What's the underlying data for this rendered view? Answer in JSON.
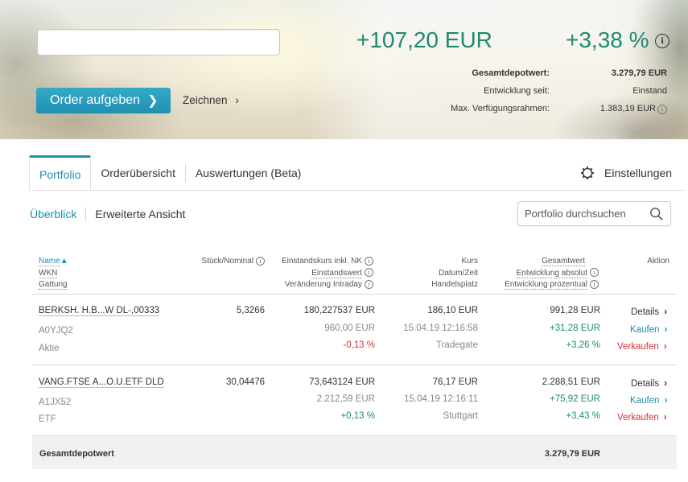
{
  "hero": {
    "search_value": "",
    "order_button": "Order aufgeben",
    "sign_link": "Zeichnen",
    "change_absolute": "+107,20 EUR",
    "change_percent": "+3,38 %",
    "stats": [
      {
        "label": "Gesamtdepotwert:",
        "value": "3.279,79 EUR"
      },
      {
        "label": "Entwicklung seit:",
        "value": "Einstand"
      },
      {
        "label": "Max. Verfügungsrahmen:",
        "value": "1.383,19 EUR"
      }
    ]
  },
  "tabs": [
    {
      "label": "Portfolio",
      "active": true
    },
    {
      "label": "Orderübersicht",
      "active": false
    },
    {
      "label": "Auswertungen (Beta)",
      "active": false
    }
  ],
  "settings_label": "Einstellungen",
  "subnav": [
    {
      "label": "Überblick",
      "active": true
    },
    {
      "label": "Erweiterte Ansicht",
      "active": false
    }
  ],
  "portfolio_search_placeholder": "Portfolio durchsuchen",
  "table": {
    "headers": {
      "name": "Name",
      "wkn": "WKN",
      "gattung": "Gattung",
      "stueck": "Stück/Nominal",
      "einstandskurs": "Einstandskurs inkl. NK",
      "einstandswert": "Einstandswert",
      "veraenderung": "Veränderung Intraday",
      "kurs": "Kurs",
      "datum": "Datum/Zeit",
      "handelsplatz": "Handelsplatz",
      "gesamtwert": "Gesamtwert",
      "entw_abs": "Entwicklung absolut",
      "entw_pct": "Entwicklung prozentual",
      "aktion": "Aktion"
    },
    "rows": [
      {
        "name": "BERKSH. H.B...W DL-,00333",
        "wkn": "A0YJQ2",
        "gattung": "Aktie",
        "stueck": "5,3266",
        "einstandskurs": "180,227537 EUR",
        "einstandswert": "960,00 EUR",
        "veraenderung": "-0,13 %",
        "kurs": "186,10 EUR",
        "datum": "15.04.19 12:16:58",
        "handelsplatz": "Tradegate",
        "gesamtwert": "991,28 EUR",
        "entw_abs": "+31,28 EUR",
        "entw_pct": "+3,26 %",
        "actions": [
          "Details",
          "Kaufen",
          "Verkaufen"
        ]
      },
      {
        "name": "VANG.FTSE A...O.U.ETF DLD",
        "wkn": "A1JX52",
        "gattung": "ETF",
        "stueck": "30,04476",
        "einstandskurs": "73,643124 EUR",
        "einstandswert": "2.212,59 EUR",
        "veraenderung": "+0,13 %",
        "kurs": "76,17 EUR",
        "datum": "15.04.19 12:16:11",
        "handelsplatz": "Stuttgart",
        "gesamtwert": "2.288,51 EUR",
        "entw_abs": "+75,92 EUR",
        "entw_pct": "+3,43 %",
        "actions": [
          "Details",
          "Kaufen",
          "Verkaufen"
        ]
      }
    ],
    "total_label": "Gesamtdepotwert",
    "total_value": "3.279,79 EUR"
  },
  "colors": {
    "accent": "#1b8fb1",
    "positive": "#1f8a6d",
    "negative": "#d0343a",
    "button": "#2a9cbf"
  }
}
